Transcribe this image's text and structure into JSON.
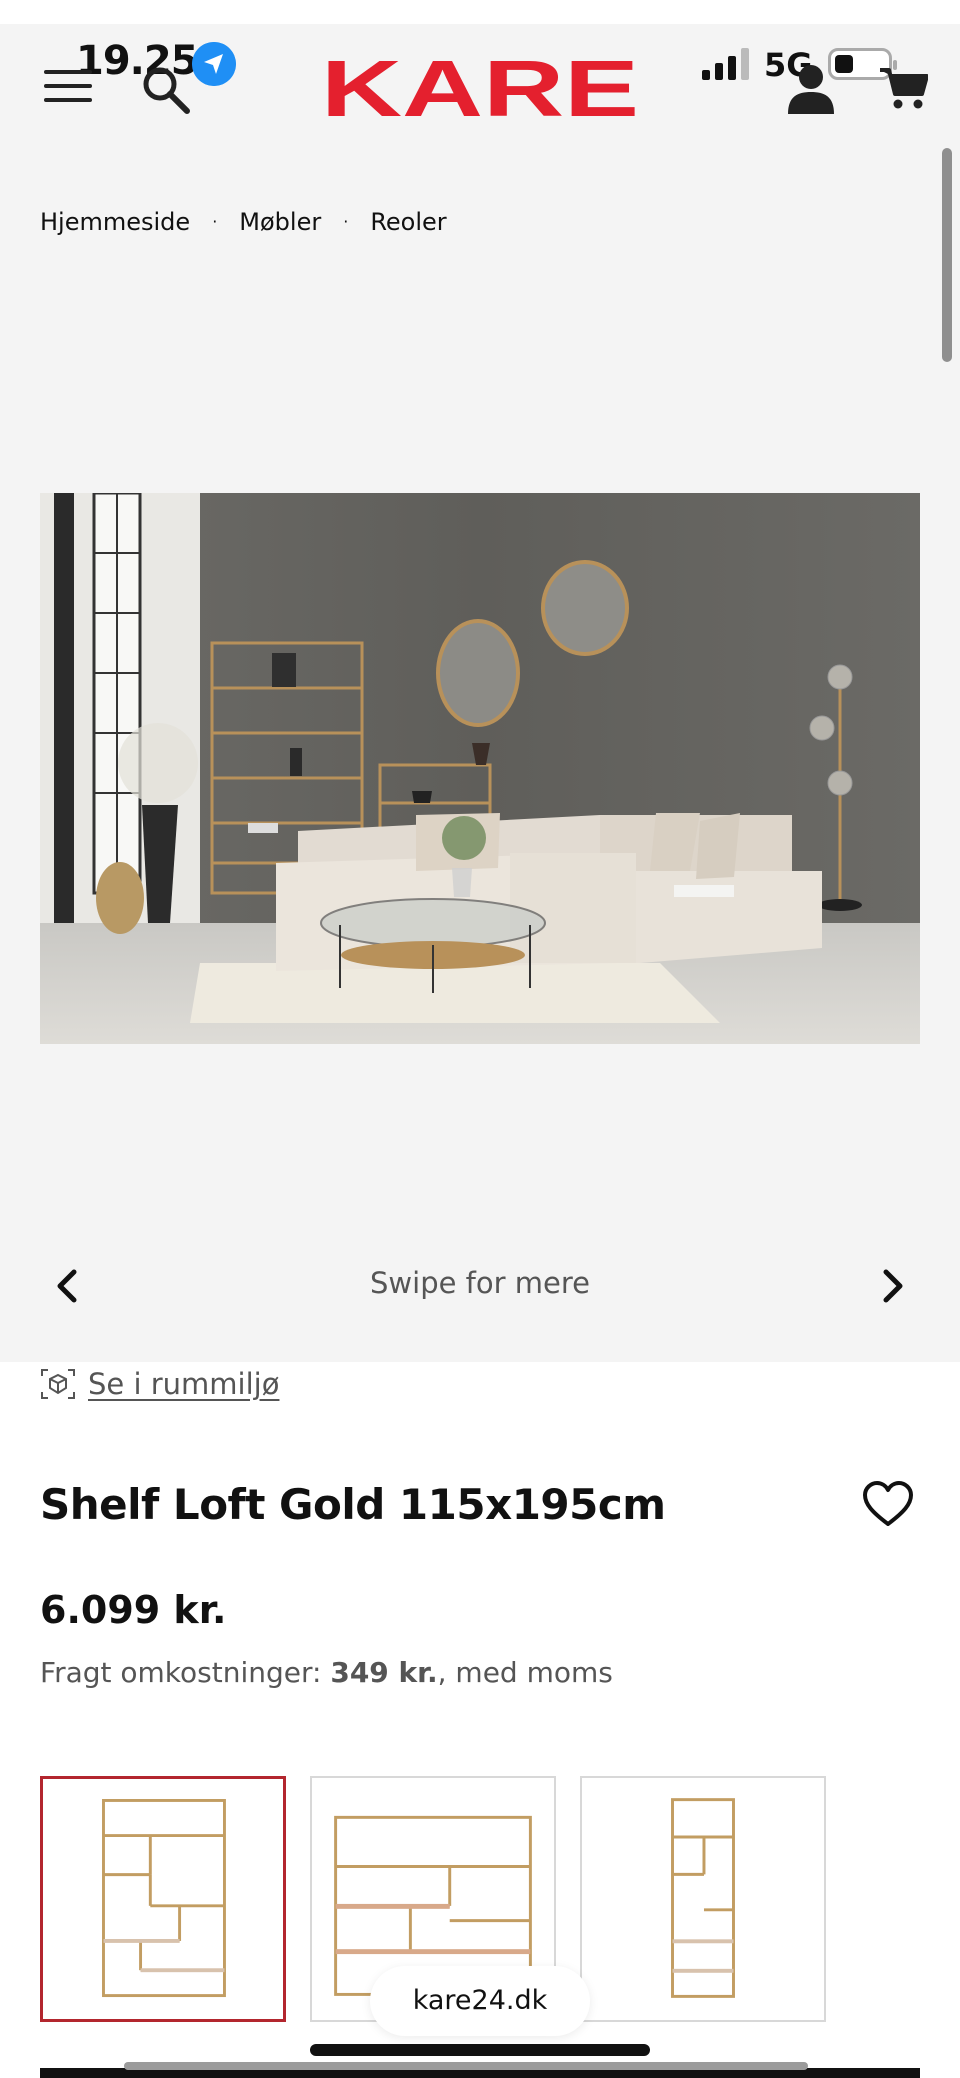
{
  "status_bar": {
    "time": "19.25",
    "network": "5G",
    "icons": [
      "location-arrow-icon",
      "cellular-signal-icon",
      "battery-icon"
    ]
  },
  "header": {
    "logo_text": "KARE",
    "brand_color": "#e4202e",
    "icons": [
      "menu-icon",
      "search-icon",
      "account-icon",
      "cart-icon"
    ]
  },
  "breadcrumb": {
    "items": [
      "Hjemmeside",
      "Møbler",
      "Reoler"
    ],
    "separator": "·"
  },
  "gallery": {
    "swipe_label": "Swipe for mere",
    "icons": [
      "chevron-left-icon",
      "chevron-right-icon"
    ]
  },
  "room_view": {
    "label": "Se i rummiljø",
    "icon": "ar-view-icon"
  },
  "product": {
    "title": "Shelf Loft Gold 115x195cm",
    "price": "6.099 kr.",
    "shipping_label": "Fragt omkostninger:",
    "shipping_cost": "349 kr.",
    "shipping_suffix": ", med moms",
    "wishlist_icon": "heart-icon",
    "selected_variant_color": "#b3262e"
  },
  "browser": {
    "url": "kare24.dk"
  }
}
